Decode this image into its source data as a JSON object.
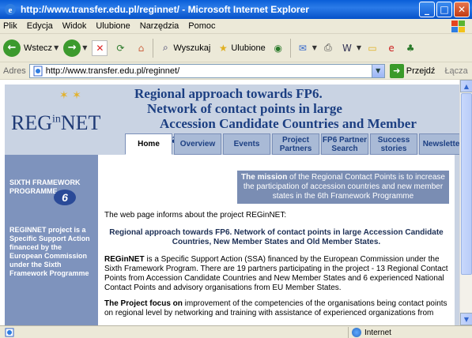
{
  "window": {
    "title": "http://www.transfer.edu.pl/reginnet/ - Microsoft Internet Explorer"
  },
  "menu": [
    "Plik",
    "Edycja",
    "Widok",
    "Ulubione",
    "Narzędzia",
    "Pomoc"
  ],
  "toolbar": {
    "back_label": "Wstecz",
    "search_label": "Wyszukaj",
    "favorites_label": "Ulubione"
  },
  "address": {
    "label": "Adres",
    "url": "http://www.transfer.edu.pl/reginnet/",
    "go_label": "Przejdź",
    "links_label": "Łącza"
  },
  "site": {
    "logo": "REG",
    "logo_mid": "in",
    "logo_end": "NET",
    "headline": [
      "Regional approach towards FP6.",
      "Network of contact points in large",
      "Accession Candidate Countries and Member States"
    ],
    "tabs": [
      "Home",
      "Overview",
      "Events",
      "Project Partners",
      "FP6 Partner Search",
      "Success stories",
      "Newsletter"
    ],
    "left": {
      "fp6": "SIXTH FRAMEWORK PROGRAMME",
      "fp6_logo": "6",
      "desc": "REGINNET project is a Specific Support Action financed by the European Commission under the Sixth Framework Programme"
    },
    "mission_bold": "The mission",
    "mission_rest": " of the Regional Contact Points is to increase the participation of accession countries and new member states in the 6th Framework Programme",
    "intro": "The web page informs about the project REGinNET:",
    "main_heading": "Regional approach towards FP6. Network of contact points in large Accession Candidate Countries, New Member States and Old Member States.",
    "para1_bold": "REGinNET",
    "para1_rest": " is a Specific Support Action (SSA) financed by the European Commission under the Sixth Framework Program. There are 19 partners participating in the project - 13 Regional Contact Points from Accession Candidate Countries and New Member States and 6 experienced National Contact Points and advisory organisations from EU Member States.",
    "para2_bold": "The Project focus on",
    "para2_rest": " improvement of the competencies of the organisations being contact points on regional level by networking and training with assistance of experienced organizations from"
  },
  "status": {
    "zone": "Internet"
  },
  "colors": {
    "titlebar": "#0a5fd8",
    "site_bg": "#c9d3e3",
    "headline": "#1c3f82",
    "leftcol": "#7e93bd"
  }
}
